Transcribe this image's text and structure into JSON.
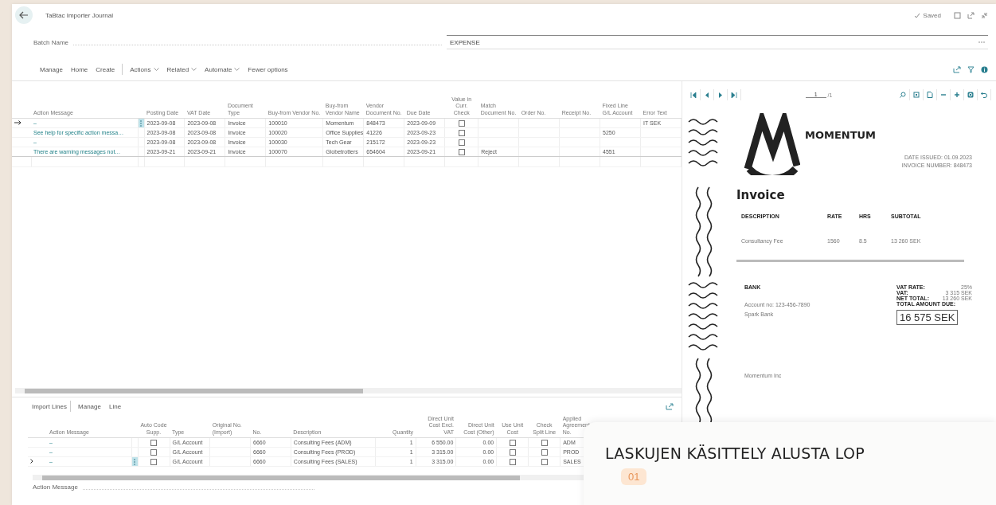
{
  "header": {
    "title": "TaBtac Importer Journal",
    "status": "Saved"
  },
  "batch": {
    "label": "Batch Name",
    "value": "EXPENSE"
  },
  "action_bar": {
    "items": [
      {
        "label": "Manage",
        "kind": "tab"
      },
      {
        "label": "Home",
        "kind": "tab"
      },
      {
        "label": "Create",
        "kind": "tab"
      },
      {
        "label": "Actions",
        "kind": "menu"
      },
      {
        "label": "Related",
        "kind": "menu"
      },
      {
        "label": "Automate",
        "kind": "menu"
      },
      {
        "label": "Fewer options",
        "kind": "link"
      }
    ]
  },
  "journal": {
    "columns": [
      {
        "label": "Action Message",
        "kind": "link"
      },
      {
        "label": "Posting Date",
        "kind": "text"
      },
      {
        "label": "VAT Date",
        "kind": "text"
      },
      {
        "label": "Document Type",
        "kind": "text"
      },
      {
        "label": "Buy-from Vendor No.",
        "kind": "text"
      },
      {
        "label": "Buy-from Vendor Name",
        "kind": "text"
      },
      {
        "label": "Vendor Document No.",
        "kind": "text"
      },
      {
        "label": "Due Date",
        "kind": "text"
      },
      {
        "label": "Value in Curr. Check",
        "kind": "check"
      },
      {
        "label": "Match Document No.",
        "kind": "text"
      },
      {
        "label": "Order No.",
        "kind": "text"
      },
      {
        "label": "Receipt No.",
        "kind": "text"
      },
      {
        "label": "Fixed Line G/L Account",
        "kind": "text"
      },
      {
        "label": "Error Text",
        "kind": "text"
      }
    ],
    "rows": [
      {
        "selected": true,
        "checks": [
          false
        ],
        "cells": [
          "–",
          "2023-09-08",
          "2023-09-08",
          "Invoice",
          "100010",
          "Momentum",
          "848473",
          "2023-09-09",
          "",
          "",
          "",
          "",
          "",
          "IT SEK"
        ]
      },
      {
        "selected": false,
        "checks": [
          false
        ],
        "cells": [
          "See help for specific action messa…",
          "2023-09-08",
          "2023-09-08",
          "Invoice",
          "100020",
          "Office Supplies",
          "41226",
          "2023-09-23",
          "",
          "",
          "",
          "",
          "5250",
          ""
        ]
      },
      {
        "selected": false,
        "checks": [
          false
        ],
        "cells": [
          "–",
          "2023-09-08",
          "2023-09-08",
          "Invoice",
          "100030",
          "Tech Gear",
          "215172",
          "2023-09-23",
          "",
          "",
          "",
          "",
          "",
          ""
        ]
      },
      {
        "selected": false,
        "checks": [
          false
        ],
        "cells": [
          "There are warning messages not…",
          "2023-09-21",
          "2023-09-21",
          "Invoice",
          "100070",
          "Globetrotters",
          "654604",
          "2023-09-21",
          "",
          "Reject",
          "",
          "",
          "4551",
          ""
        ]
      }
    ]
  },
  "import_lines": {
    "title": "Import Lines",
    "actions": [
      "Manage",
      "Line"
    ],
    "columns": [
      {
        "label": "Action Message",
        "kind": "link"
      },
      {
        "label": "Auto Code Supp.",
        "kind": "check"
      },
      {
        "label": "Type",
        "kind": "text"
      },
      {
        "label": "Original No. (Import)",
        "kind": "text"
      },
      {
        "label": "No.",
        "kind": "text"
      },
      {
        "label": "Description",
        "kind": "text"
      },
      {
        "label": "Quantity",
        "kind": "number"
      },
      {
        "label": "Direct Unit Cost Excl. VAT",
        "kind": "number"
      },
      {
        "label": "Direct Unit Cost (Other)",
        "kind": "number"
      },
      {
        "label": "Use Unit Cost",
        "kind": "check"
      },
      {
        "label": "Check Split Line",
        "kind": "check"
      },
      {
        "label": "Applied Agreement No.",
        "kind": "text"
      }
    ],
    "rows": [
      {
        "selected": false,
        "checks": [
          false,
          false,
          false
        ],
        "cells": [
          "–",
          "",
          "G/L Account",
          "",
          "6660",
          "Consulting Fees (ADM)",
          "1",
          "6 550.00",
          "0.00",
          "",
          "",
          "ADM"
        ]
      },
      {
        "selected": false,
        "checks": [
          false,
          false,
          false
        ],
        "cells": [
          "–",
          "",
          "G/L Account",
          "",
          "6660",
          "Consulting Fees (PROD)",
          "1",
          "3 315.00",
          "0.00",
          "",
          "",
          "PROD"
        ]
      },
      {
        "selected": true,
        "checks": [
          false,
          false,
          false
        ],
        "cells": [
          "–",
          "",
          "G/L Account",
          "",
          "6660",
          "Consulting Fees (SALES)",
          "1",
          "3 315.00",
          "0.00",
          "",
          "",
          "SALES"
        ]
      }
    ],
    "footer_field": {
      "label": "Action Message"
    }
  },
  "viewer": {
    "page": "1",
    "page_count": "/1",
    "document": {
      "company": "MOMENTUM",
      "date_issued": "DATE ISSUED: 01.09.2023",
      "invoice_number": "INVOICE NUMBER: 848473",
      "heading": "Invoice",
      "table_headers": [
        "DESCRIPTION",
        "RATE",
        "HRS",
        "SUBTOTAL"
      ],
      "table_row": [
        "Consultancy Fee",
        "1560",
        "8.5",
        "13 260 SEK"
      ],
      "bank_title": "BANK",
      "bank_lines": [
        "Account no: 123-456-7890",
        "Spark Bank"
      ],
      "totals": [
        {
          "label": "VAT RATE:",
          "value": "25%"
        },
        {
          "label": "VAT:",
          "value": "3 315 SEK"
        },
        {
          "label": "NET TOTAL:",
          "value": "13 260 SEK"
        }
      ],
      "due_label": "TOTAL AMOUNT DUE:",
      "due_amount": "16 575 SEK",
      "footer": "Momentum Inc"
    }
  },
  "overlay": {
    "title": "LASKUJEN KÄSITTELY ALUSTA LOP",
    "badge": "01"
  }
}
